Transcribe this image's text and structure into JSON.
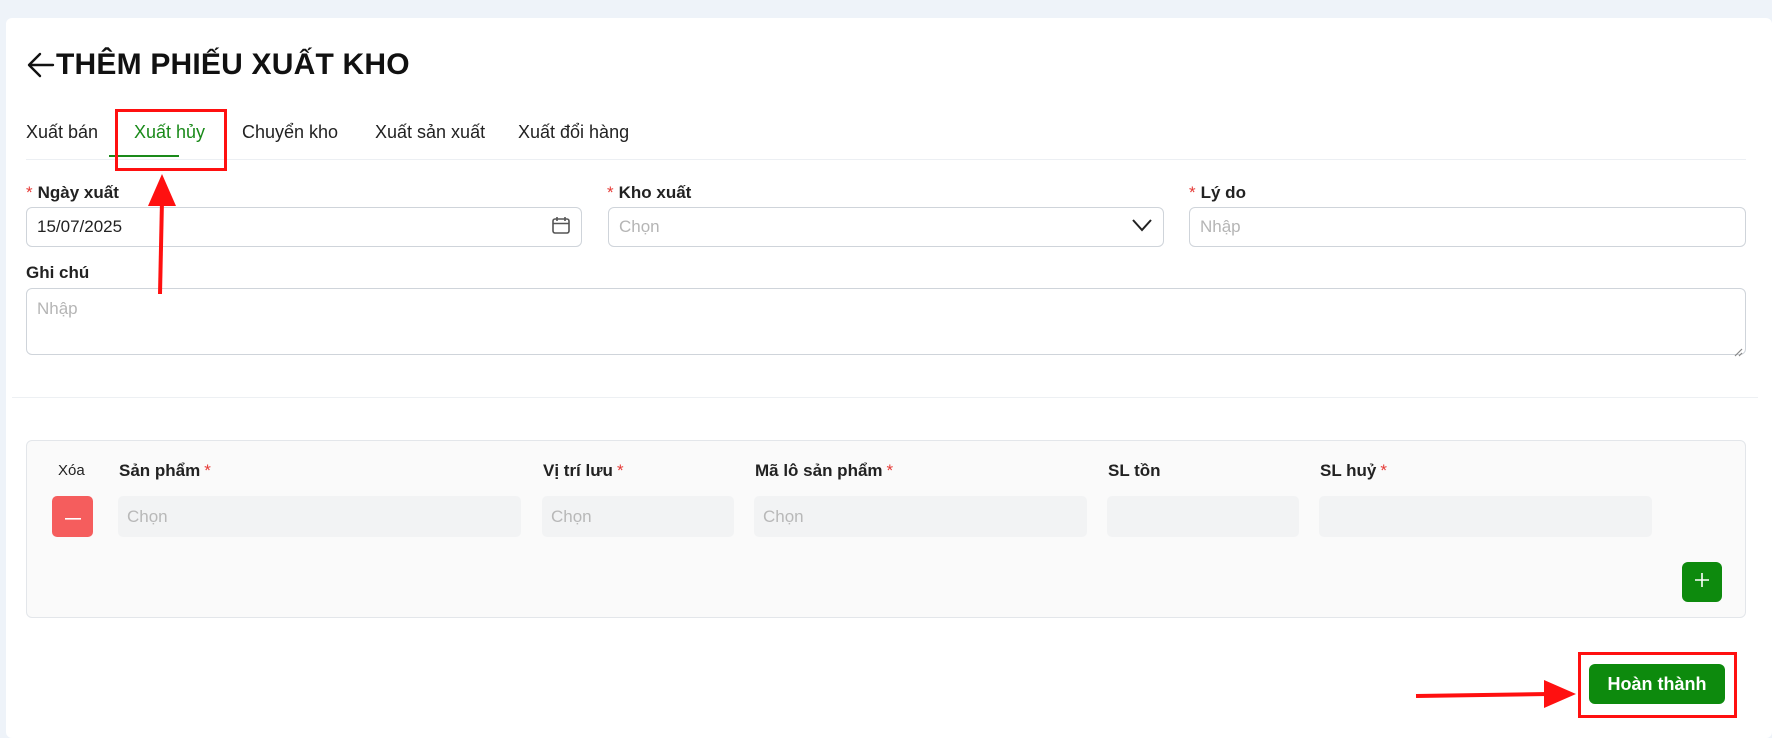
{
  "page": {
    "title": "THÊM PHIẾU XUẤT KHO",
    "back_icon": "arrow-left-icon"
  },
  "tabs": [
    {
      "label": "Xuất bán",
      "active": false
    },
    {
      "label": "Xuất hủy",
      "active": true
    },
    {
      "label": "Chuyển kho",
      "active": false
    },
    {
      "label": "Xuất sản xuất",
      "active": false
    },
    {
      "label": "Xuất đổi hàng",
      "active": false
    }
  ],
  "form": {
    "required_mark": "*",
    "export_date": {
      "label": "Ngày xuất",
      "value": "15/07/2025",
      "icon": "calendar-icon"
    },
    "warehouse": {
      "label": "Kho xuất",
      "placeholder": "Chọn",
      "icon": "chevron-down-icon"
    },
    "reason": {
      "label": "Lý do",
      "placeholder": "Nhập"
    },
    "note": {
      "label": "Ghi chú",
      "placeholder": "Nhập"
    }
  },
  "items_table": {
    "headers": {
      "delete": "Xóa",
      "product": "Sản phẩm",
      "location": "Vị trí lưu",
      "lot": "Mã lô sản phẩm",
      "stock": "SL tồn",
      "destroy_qty": "SL huỷ"
    },
    "rows": [
      {
        "product": "Chọn",
        "location": "Chọn",
        "lot": "Chọn",
        "stock": "",
        "destroy_qty": ""
      }
    ],
    "delete_icon": "minus-icon",
    "add_icon": "plus-icon"
  },
  "actions": {
    "submit_label": "Hoàn thành"
  },
  "colors": {
    "accent": "#0d8a0d",
    "danger": "#f55d5d",
    "annotation": "#ff1010"
  }
}
